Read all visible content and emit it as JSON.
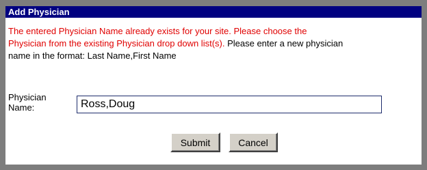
{
  "dialog": {
    "title": "Add Physician"
  },
  "message": {
    "error_line1": "The entered Physician Name already exists for your site. Please choose the",
    "error_line2": "Physician from the existing Physician drop down list(s).",
    "info_line2": " Please enter a new physician",
    "info_line3": "name in the format: Last Name,First Name"
  },
  "form": {
    "label_line1": "Physician",
    "label_line2": "Name:",
    "name_value": "Ross,Doug"
  },
  "buttons": {
    "submit_label": "Submit",
    "cancel_label": "Cancel"
  },
  "colors": {
    "title_bar": "#000080",
    "error_text": "#e00000",
    "border": "#7d7d7d",
    "button_face": "#d4d0c8"
  }
}
